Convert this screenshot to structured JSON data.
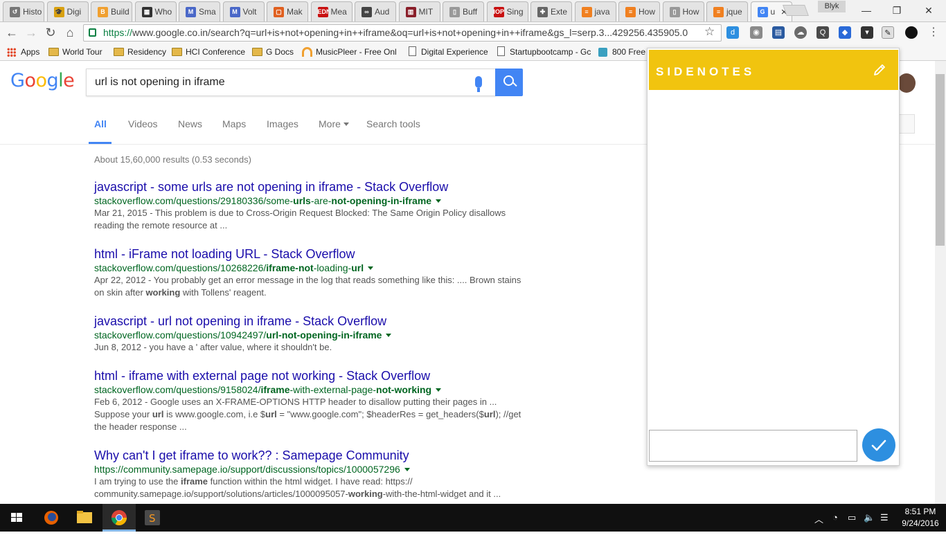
{
  "tabs": [
    {
      "label": "Histo",
      "icon_color": "#777777",
      "icon_glyph": "↺"
    },
    {
      "label": "Digi",
      "icon_color": "#d8a010",
      "icon_glyph": "🎓"
    },
    {
      "label": "Build",
      "icon_color": "#f0a030",
      "icon_glyph": "B"
    },
    {
      "label": "Who",
      "icon_color": "#333333",
      "icon_glyph": "▦"
    },
    {
      "label": "Sma",
      "icon_color": "#4a68c8",
      "icon_glyph": "M"
    },
    {
      "label": "Volt",
      "icon_color": "#4a68c8",
      "icon_glyph": "M"
    },
    {
      "label": "Mak",
      "icon_color": "#e06020",
      "icon_glyph": "▢"
    },
    {
      "label": "Mea",
      "icon_color": "#c81010",
      "icon_glyph": "EDN"
    },
    {
      "label": "Aud",
      "icon_color": "#444444",
      "icon_glyph": "∞"
    },
    {
      "label": "MIT",
      "icon_color": "#8a1f2a",
      "icon_glyph": "▥"
    },
    {
      "label": "Buff",
      "icon_color": "#999999",
      "icon_glyph": "▯"
    },
    {
      "label": "Sing",
      "icon_color": "#c81010",
      "icon_glyph": "IOP"
    },
    {
      "label": "Exte",
      "icon_color": "#666666",
      "icon_glyph": "✚"
    },
    {
      "label": "java",
      "icon_color": "#f08020",
      "icon_glyph": "≡"
    },
    {
      "label": "How",
      "icon_color": "#f08020",
      "icon_glyph": "≡"
    },
    {
      "label": "How",
      "icon_color": "#999999",
      "icon_glyph": "▯"
    },
    {
      "label": "jque",
      "icon_color": "#f08020",
      "icon_glyph": "≡"
    },
    {
      "label": "u",
      "icon_color": "#4285f4",
      "icon_glyph": "G"
    }
  ],
  "profile_name": "Blyk",
  "window_controls": {
    "minimize": "—",
    "restore": "❐",
    "close": "✕"
  },
  "address_bar": {
    "scheme": "https://",
    "url": "www.google.co.in/search?q=url+is+not+opening+in++iframe&oq=url+is+not+opening+in++iframe&gs_l=serp.3...429256.435905.0"
  },
  "bookmarks": [
    {
      "label": "Apps",
      "kind": "apps"
    },
    {
      "label": "World Tour",
      "kind": "folder"
    },
    {
      "label": "Residency",
      "kind": "folder"
    },
    {
      "label": "HCI Conference",
      "kind": "folder"
    },
    {
      "label": "G Docs",
      "kind": "folder"
    },
    {
      "label": "MusicPleer - Free Onl",
      "kind": "music"
    },
    {
      "label": "Digital Experience",
      "kind": "page"
    },
    {
      "label": "Startupbootcamp - Gc",
      "kind": "page"
    },
    {
      "label": "800 Free",
      "kind": "site"
    }
  ],
  "search": {
    "logo": [
      "G",
      "o",
      "o",
      "g",
      "l",
      "e"
    ],
    "logo_colors": [
      "#4285f4",
      "#ea4335",
      "#fbbc05",
      "#4285f4",
      "#34a853",
      "#ea4335"
    ],
    "query": "url is not opening in  iframe"
  },
  "search_tabs": [
    "All",
    "Videos",
    "News",
    "Maps",
    "Images",
    "More",
    "Search tools"
  ],
  "stats": "About 15,60,000 results (0.53 seconds)",
  "results": [
    {
      "title": "javascript - some urls are not opening in iframe - Stack Overflow",
      "url_parts": [
        [
          "stackoverflow.com/questions/29180336/some-",
          false
        ],
        [
          "urls",
          true
        ],
        [
          "-are-",
          false
        ],
        [
          "not-opening-in-iframe",
          true
        ]
      ],
      "snippet_parts": [
        [
          "Mar 21, 2015 - This problem is due to Cross-Origin Request Blocked: The Same Origin Policy disallows reading the remote resource at ...",
          false
        ]
      ]
    },
    {
      "title": "html - iFrame not loading URL - Stack Overflow",
      "url_parts": [
        [
          "stackoverflow.com/questions/10268226/",
          false
        ],
        [
          "iframe-not",
          true
        ],
        [
          "-loading-",
          false
        ],
        [
          "url",
          true
        ]
      ],
      "snippet_parts": [
        [
          "Apr 22, 2012 - You probably get an error message in the log that reads something like this: .... Brown stains on skin after ",
          false
        ],
        [
          "working",
          true
        ],
        [
          " with Tollens' reagent.",
          false
        ]
      ]
    },
    {
      "title": "javascript - url not opening in iframe - Stack Overflow",
      "url_parts": [
        [
          "stackoverflow.com/questions/10942497/",
          false
        ],
        [
          "url-not-opening-in-iframe",
          true
        ]
      ],
      "snippet_parts": [
        [
          "Jun 8, 2012 - you have a ' after value, where it shouldn't be.",
          false
        ]
      ]
    },
    {
      "title": "html - iframe with external page not working - Stack Overflow",
      "url_parts": [
        [
          "stackoverflow.com/questions/9158024/",
          false
        ],
        [
          "iframe",
          true
        ],
        [
          "-with-external-page-",
          false
        ],
        [
          "not-working",
          true
        ]
      ],
      "snippet_parts": [
        [
          "Feb 6, 2012 - Google uses an X-FRAME-OPTIONS HTTP header to disallow putting their pages in ... Suppose your ",
          false
        ],
        [
          "url",
          true
        ],
        [
          " is www.google.com, i.e $",
          false
        ],
        [
          "url",
          true
        ],
        [
          " = \"www.google.com\"; $headerRes = get_headers($",
          false
        ],
        [
          "url",
          true
        ],
        [
          ");  //get the header response ...",
          false
        ]
      ]
    },
    {
      "title": "Why can't I get iframe to work?? : Samepage Community",
      "url_parts": [
        [
          "https://community.samepage.io/support/discussions/topics/1000057296",
          false
        ]
      ],
      "snippet_parts": [
        [
          "I am trying to use the ",
          false
        ],
        [
          "iframe",
          true
        ],
        [
          " function within the html widget. I have read: https:// community.samepage.io/support/solutions/articles/1000095057-",
          false
        ],
        [
          "working",
          true
        ],
        [
          "-with-the-html-widget and it ...",
          false
        ]
      ]
    }
  ],
  "sidenotes": {
    "title": "SIDENOTES",
    "note_text": ""
  },
  "taskbar": {
    "time": "8:51 PM",
    "date": "9/24/2016"
  }
}
